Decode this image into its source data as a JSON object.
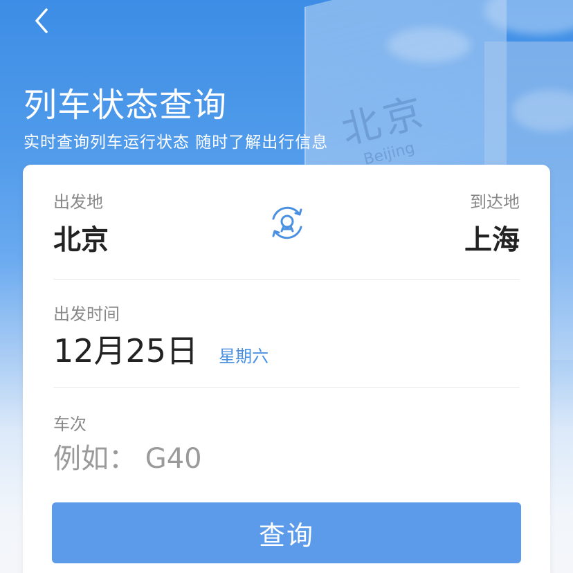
{
  "header": {
    "title": "列车状态查询",
    "subtitle": "实时查询列车运行状态 随时了解出行信息",
    "back_icon": "chevron-left-icon"
  },
  "background": {
    "sign_text": "北京",
    "sign_sub": "Beijing"
  },
  "route": {
    "from_label": "出发地",
    "from_station": "北京",
    "to_label": "到达地",
    "to_station": "上海",
    "swap_icon": "swap-railway-icon"
  },
  "date": {
    "label": "出发时间",
    "value": "12月25日",
    "weekday": "星期六"
  },
  "train": {
    "label": "车次",
    "placeholder": "例如： G40",
    "value": ""
  },
  "actions": {
    "query_label": "查询"
  },
  "colors": {
    "accent": "#5c9bea",
    "link": "#4a90e2",
    "header_bg": "#3d8de6",
    "text_primary": "#222222",
    "text_secondary": "#888888"
  }
}
